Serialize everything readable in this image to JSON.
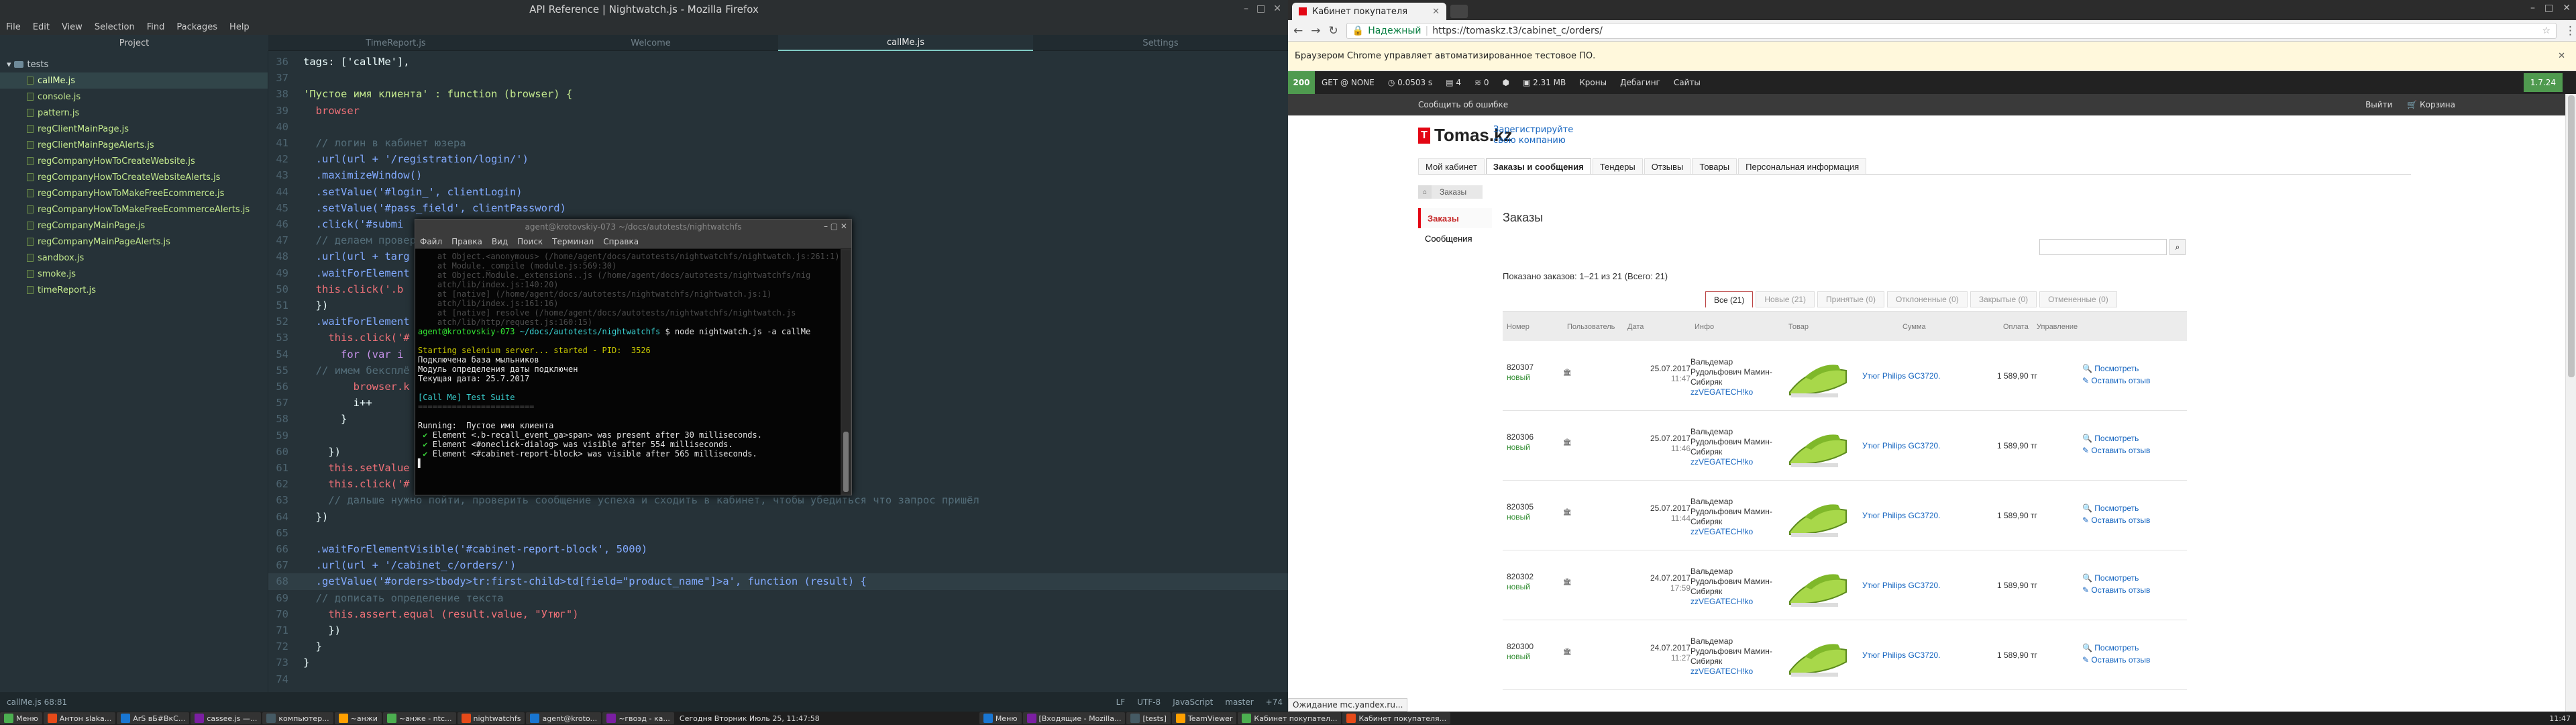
{
  "editor": {
    "window_title": "API Reference | Nightwatch.js - Mozilla Firefox",
    "menu": [
      "File",
      "Edit",
      "View",
      "Selection",
      "Find",
      "Packages",
      "Help"
    ],
    "tree_header": "Project",
    "tabs": [
      {
        "label": "TimeReport.js",
        "active": false
      },
      {
        "label": "Welcome",
        "active": false
      },
      {
        "label": "callMe.js",
        "active": true
      },
      {
        "label": "Settings",
        "active": false
      }
    ],
    "tree_root": "tests",
    "files": [
      "callMe.js",
      "console.js",
      "pattern.js",
      "regClientMainPage.js",
      "regClientMainPageAlerts.js",
      "regCompanyHowToCreateWebsite.js",
      "regCompanyHowToCreateWebsiteAlerts.js",
      "regCompanyHowToMakeFreeEcommerce.js",
      "regCompanyHowToMakeFreeEcommerceAlerts.js",
      "regCompanyMainPage.js",
      "regCompanyMainPageAlerts.js",
      "sandbox.js",
      "smoke.js",
      "timeReport.js"
    ],
    "selected_file": "callMe.js",
    "line_numbers": [
      "36",
      "37",
      "38",
      "39",
      "40",
      "41",
      "42",
      "43",
      "44",
      "45",
      "46",
      "47",
      "48",
      "49",
      "50",
      "51",
      "52",
      "53",
      "54",
      "55",
      "56",
      "57",
      "58",
      "59",
      "60",
      "61",
      "62",
      "63",
      "64",
      "65",
      "66",
      "67",
      "68",
      "69",
      "70",
      "71",
      "72",
      "73",
      "74"
    ],
    "lines": [
      "tags: ['callMe'],",
      "",
      "'Пустое имя клиента' : function (browser) {",
      "  browser",
      "",
      "  // логин в кабинет юзера",
      "  .url(url + '/registration/login/')",
      "  .maximizeWindow()",
      "  .setValue('#login_', clientLogin)",
      "  .setValue('#pass_field', clientPassword)",
      "  .click('#submi",
      "  // делаем провер",
      "  .url(url + targ",
      "  .waitForElement",
      "  this.click('.b",
      "  })",
      "  .waitForElement",
      "    this.click('#",
      "      for (var i",
      "  // имем бексплё",
      "        browser.k",
      "        i++",
      "      }",
      "",
      "    })",
      "    this.setValue",
      "    this.click('#",
      "    // дальше нужно пойти, проверить сообщение успеха и сходить в кабинет, чтобы убедиться что запрос пришёл",
      "  })",
      "",
      "  .waitForElementVisible('#cabinet-report-block', 5000)",
      "  .url(url + '/cabinet_c/orders/')",
      "  .getValue('#orders>tbody>tr:first-child>td[field=\"product_name\"]>a', function (result) {",
      "  // дописать определение текста",
      "    this.assert.equal (result.value, \"Утюг\")",
      "    })",
      "  }",
      "}",
      ""
    ],
    "status_left": "callMe.js   68:81",
    "status_right": [
      "LF",
      "UTF-8",
      "JavaScript",
      "master",
      "+74"
    ]
  },
  "terminal": {
    "title": "agent@krotovskiy-073 ~/docs/autotests/nightwatchfs",
    "menu": [
      "Файл",
      "Правка",
      "Вид",
      "Поиск",
      "Терминал",
      "Справка"
    ],
    "lines_dim": [
      "    at Object.<anonymous> (/home/agent/docs/autotests/nightwatchfs/nightwatch.js:261:1)",
      "    at Module._compile (module.js:569:30)",
      "    at Object.Module._extensions..js (/home/agent/docs/autotests/nightwatchfs/nig",
      "    atch/lib/index.js:140:20)",
      "    at [native] (/home/agent/docs/autotests/nightwatchfs/nightwatch.js:1)",
      "    atch/lib/index.js:161:16)",
      "    at [native] resolve (/home/agent/docs/autotests/nightwatchfs/nightwatch.js",
      "    atch/lib/http/request.js:160:15)"
    ],
    "prompt": "agent@krotovskiy-073",
    "path": "~/docs/autotests/nightwatchfs",
    "command": "$ node nightwatch.js -a callMe",
    "selenium": "Starting selenium server... started - PID:  3526",
    "out": [
      "Подключена база мыльников",
      "Модуль определения даты подключен",
      "Текущая дата: 25.7.2017"
    ],
    "suite": "[Call Me] Test Suite",
    "suite_rule": "========================",
    "running": "Running:  Пустое имя клиента",
    "results": [
      "Element <.b-recall_event_ga>span> was present after 30 milliseconds.",
      "Element <#oneclick-dialog> was visible after 554 milliseconds.",
      "Element <#cabinet-report-block> was visible after 565 milliseconds."
    ]
  },
  "chrome": {
    "tab_title": "Кабинет покупателя",
    "url_secure": "Надежный",
    "url": "https://tomaskz.t3/cabinet_c/orders/",
    "infobar": "Браузером Chrome управляет автоматизированное тестовое ПО.",
    "debugbar": {
      "code": "200",
      "method": "GET @ NONE",
      "time": "0.0503 s",
      "db": "4",
      "count": "0",
      "mem": "2.31 MB",
      "links": [
        "Кроны",
        "Дебагинг",
        "Сайты"
      ],
      "version": "1.7.24"
    },
    "topline_left": "Сообщить об ошибке",
    "topline_right": [
      "Выйти",
      "Корзина"
    ],
    "logo": "Tomas.kz",
    "register": [
      "Зарегистрируйте",
      "свою компанию"
    ],
    "page_tabs": [
      {
        "label": "Мой кабинет",
        "active": false
      },
      {
        "label": "Заказы и сообщения",
        "active": true
      },
      {
        "label": "Тендеры",
        "active": false
      },
      {
        "label": "Отзывы",
        "active": false
      },
      {
        "label": "Товары",
        "active": false
      },
      {
        "label": "Персональная информация",
        "active": false
      }
    ],
    "breadcrumb": "Заказы",
    "sidenav": [
      {
        "label": "Заказы",
        "active": true
      },
      {
        "label": "Сообщения",
        "active": false
      }
    ],
    "heading": "Заказы",
    "shown_text": "Показано заказов: 1–21 из 21 (Всего: 21)",
    "filters": [
      {
        "label": "Все (21)",
        "active": true
      },
      {
        "label": "Новые (21)",
        "active": false
      },
      {
        "label": "Принятые (0)",
        "active": false
      },
      {
        "label": "Отклоненные (0)",
        "active": false
      },
      {
        "label": "Закрытые (0)",
        "active": false
      },
      {
        "label": "Отмененные (0)",
        "active": false
      }
    ],
    "columns": [
      "Номер",
      "Пользователь",
      "Дата",
      "Инфо",
      "Товар",
      "Сумма",
      "Оплата",
      "Управление"
    ],
    "orders": [
      {
        "num": "820307",
        "status": "новый",
        "date": "25.07.2017",
        "time": "11:47",
        "name": "Вальдемар Рудольфович Мамин-Сибиряк",
        "company": "zzVEGATECH!ko",
        "product": "Утюг Philips GC3720.",
        "sum": "1 589,90 тг",
        "view": "Посмотреть",
        "review": "Оставить отзыв"
      },
      {
        "num": "820306",
        "status": "новый",
        "date": "25.07.2017",
        "time": "11:46",
        "name": "Вальдемар Рудольфович Мамин-Сибиряк",
        "company": "zzVEGATECH!ko",
        "product": "Утюг Philips GC3720.",
        "sum": "1 589,90 тг",
        "view": "Посмотреть",
        "review": "Оставить отзыв"
      },
      {
        "num": "820305",
        "status": "новый",
        "date": "25.07.2017",
        "time": "11:44",
        "name": "Вальдемар Рудольфович Мамин-Сибиряк",
        "company": "zzVEGATECH!ko",
        "product": "Утюг Philips GC3720.",
        "sum": "1 589,90 тг",
        "view": "Посмотреть",
        "review": "Оставить отзыв"
      },
      {
        "num": "820302",
        "status": "новый",
        "date": "24.07.2017",
        "time": "17:59",
        "name": "Вальдемар Рудольфович Мамин-Сибиряк",
        "company": "zzVEGATECH!ko",
        "product": "Утюг Philips GC3720.",
        "sum": "1 589,90 тг",
        "view": "Посмотреть",
        "review": "Оставить отзыв"
      },
      {
        "num": "820300",
        "status": "новый",
        "date": "24.07.2017",
        "time": "11:27",
        "name": "Вальдемар Рудольфович Мамин-Сибиряк",
        "company": "zzVEGATECH!ko",
        "product": "Утюг Philips GC3720.",
        "sum": "1 589,90 тг",
        "view": "Посмотреть",
        "review": "Оставить отзыв"
      }
    ],
    "statusbar": "Ожидание mc.yandex.ru..."
  },
  "taskbar": {
    "left_items": [
      "Меню",
      "Антон slaka...",
      "ArS вБ#ВкС...",
      "cassee.js —...",
      "компьютер...",
      "~анжи",
      "~анже - ntc...",
      "nightwatchfs",
      "agent@krotо...",
      "~гвоэд - ка..."
    ],
    "clock_left": "Сегодня Вторник Июль 25, 11:47:58",
    "right_items": [
      "Меню",
      "[Входящие - Mozilla...",
      "[tests]",
      "TeamViewer",
      "Кабинет покупател...",
      "Кабинет покупателя..."
    ],
    "clock_right": "11:47"
  }
}
